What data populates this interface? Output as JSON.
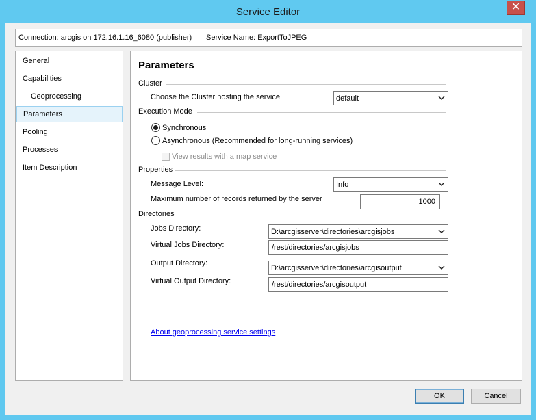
{
  "window": {
    "title": "Service Editor",
    "close_glyph": "✕",
    "title_bar_color": "#60c9f0"
  },
  "connection": {
    "text": "Connection: arcgis on 172.16.1.16_6080 (publisher)",
    "service": "Service Name: ExportToJPEG"
  },
  "sidebar": {
    "items": [
      {
        "label": "General"
      },
      {
        "label": "Capabilities"
      },
      {
        "label": "Geoprocessing"
      },
      {
        "label": "Parameters",
        "selected": true
      },
      {
        "label": "Pooling"
      },
      {
        "label": "Processes"
      },
      {
        "label": "Item Description"
      }
    ]
  },
  "main": {
    "heading": "Parameters",
    "cluster": {
      "group_label": "Cluster",
      "label": "Choose the Cluster hosting the service",
      "value": "default"
    },
    "execution": {
      "group_label": "Execution Mode",
      "sync_label": "Synchronous",
      "async_label": "Asynchronous (Recommended for long-running services)",
      "map_service_label": "View results with a map service",
      "selected": "Synchronous"
    },
    "properties": {
      "group_label": "Properties",
      "message_level_label": "Message Level:",
      "message_level_value": "Info",
      "max_records_label": "Maximum number of records returned by the server",
      "max_records_value": "1000"
    },
    "directories": {
      "group_label": "Directories",
      "jobs_label": "Jobs Directory:",
      "jobs_value": "D:\\arcgisserver\\directories\\arcgisjobs",
      "virtual_jobs_label": "Virtual Jobs Directory:",
      "virtual_jobs_value": "/rest/directories/arcgisjobs",
      "output_label": "Output Directory:",
      "output_value": "D:\\arcgisserver\\directories\\arcgisoutput",
      "virtual_output_label": "Virtual Output Directory:",
      "virtual_output_value": "/rest/directories/arcgisoutput"
    },
    "help_link": "About geoprocessing service settings"
  },
  "buttons": {
    "ok": "OK",
    "cancel": "Cancel"
  },
  "icons": {
    "dropdown": "chevron-down-icon",
    "close": "close-icon"
  }
}
